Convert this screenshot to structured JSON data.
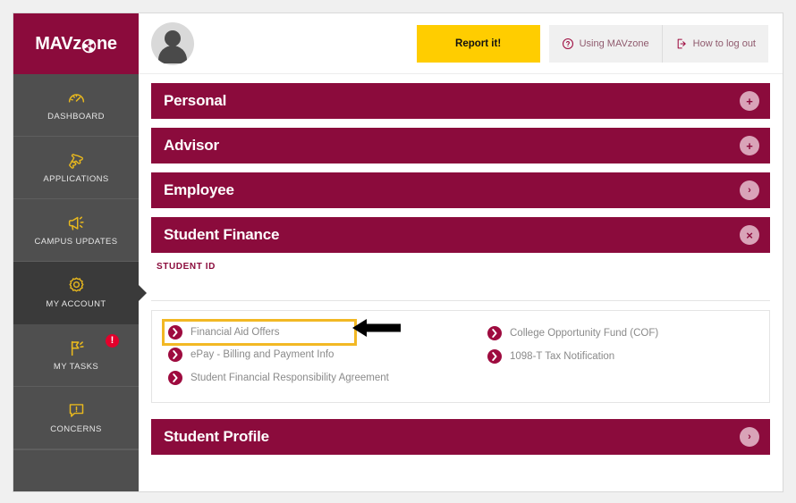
{
  "brand": {
    "name_before": "MAVz",
    "name_after": "ne",
    "logo_icon": "aperture-icon"
  },
  "sidebar": {
    "items": [
      {
        "label": "DASHBOARD",
        "icon": "gauge-icon",
        "active": false,
        "badge": null
      },
      {
        "label": "APPLICATIONS",
        "icon": "puzzle-icon",
        "active": false,
        "badge": null
      },
      {
        "label": "CAMPUS UPDATES",
        "icon": "megaphone-icon",
        "active": false,
        "badge": null
      },
      {
        "label": "MY ACCOUNT",
        "icon": "gear-icon",
        "active": true,
        "badge": null
      },
      {
        "label": "MY TASKS",
        "icon": "flag-icon",
        "active": false,
        "badge": "!"
      },
      {
        "label": "CONCERNS",
        "icon": "alert-chat-icon",
        "active": false,
        "badge": null
      }
    ]
  },
  "topbar": {
    "avatar_icon": "user-avatar-icon",
    "report_button": "Report it!",
    "help_links": [
      {
        "label": "Using MAVzone",
        "icon": "question-circle-icon"
      },
      {
        "label": "How to log out",
        "icon": "logout-icon"
      }
    ]
  },
  "accordions": [
    {
      "title": "Personal",
      "toggle": "+",
      "toggle_kind": "plus",
      "expanded": false
    },
    {
      "title": "Advisor",
      "toggle": "+",
      "toggle_kind": "plus",
      "expanded": false
    },
    {
      "title": "Employee",
      "toggle": "›",
      "toggle_kind": "chev",
      "expanded": false
    },
    {
      "title": "Student Finance",
      "toggle": "×",
      "toggle_kind": "close",
      "expanded": true
    },
    {
      "title": "Student Profile",
      "toggle": "›",
      "toggle_kind": "chev",
      "expanded": false
    }
  ],
  "student_finance": {
    "section_label": "STUDENT ID",
    "links_left": [
      {
        "label": "Financial Aid Offers",
        "highlighted": true
      },
      {
        "label": "ePay - Billing and Payment Info",
        "highlighted": false
      },
      {
        "label": "Student Financial Responsibility Agreement",
        "highlighted": false
      }
    ],
    "links_right": [
      {
        "label": "College Opportunity Fund (COF)",
        "highlighted": false
      },
      {
        "label": "1098-T Tax Notification",
        "highlighted": false
      }
    ],
    "annotation": {
      "highlight_color": "#f2b824",
      "pointer_icon": "left-arrow-annotation"
    }
  },
  "colors": {
    "maroon": "#8b0b3c",
    "gold": "#e8b81e",
    "yellow": "#ffcd00",
    "sidebar_gray": "#4f4f4f",
    "sidebar_active": "#3a3a3a",
    "alert_red": "#e3002b"
  }
}
